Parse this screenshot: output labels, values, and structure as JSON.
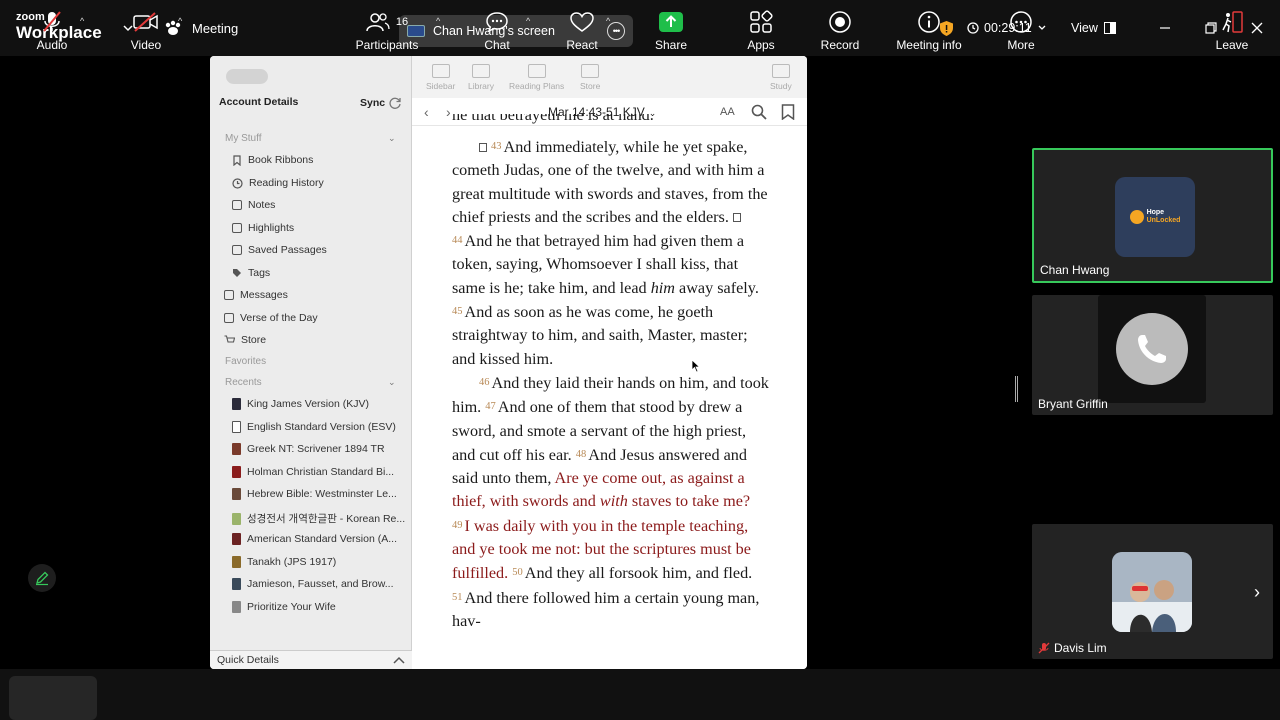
{
  "topbar": {
    "logo_top": "zoom",
    "logo_bottom": "Workplace",
    "meeting_label": "Meeting",
    "share_label": "Chan Hwang's screen",
    "timer": "00:29:11",
    "view_label": "View"
  },
  "bible_app": {
    "sidebar": {
      "account_details": "Account Details",
      "sync": "Sync",
      "my_stuff": "My Stuff",
      "my_stuff_items": [
        "Book Ribbons",
        "Reading History",
        "Notes",
        "Highlights",
        "Saved Passages",
        "Tags"
      ],
      "top_items": [
        "Messages",
        "Verse of the Day",
        "Store"
      ],
      "favorites": "Favorites",
      "recents": "Recents",
      "recent_items": [
        {
          "label": "King James Version (KJV)",
          "color": "#2b2b3a"
        },
        {
          "label": "English Standard Version (ESV)",
          "color": "#ffffff"
        },
        {
          "label": "Greek NT: Scrivener 1894 TR",
          "color": "#7a3a2a"
        },
        {
          "label": "Holman Christian Standard Bi...",
          "color": "#8a1c1c"
        },
        {
          "label": "Hebrew Bible: Westminster Le...",
          "color": "#6a4a3a"
        },
        {
          "label": "성경전서 개역한글판 - Korean Re...",
          "color": "#9ab36a"
        },
        {
          "label": "American Standard Version (A...",
          "color": "#6b2222"
        },
        {
          "label": "Tanakh (JPS 1917)",
          "color": "#8a6a2a"
        },
        {
          "label": "Jamieson, Fausset, and Brow...",
          "color": "#3a4a5a"
        },
        {
          "label": "Prioritize Your Wife",
          "color": "#888888"
        }
      ],
      "quick_details": "Quick Details"
    },
    "toolbar": {
      "sidebar": "Sidebar",
      "library": "Library",
      "reading_plans": "Reading Plans",
      "store": "Store",
      "study": "Study"
    },
    "reference": "Mar 14:43-51 KJV",
    "font_size_label": "AA",
    "passage": {
      "cutoff_line": "he that betrayeth me is at hand.",
      "v43_num": "43",
      "v43": "And immediately, while he yet spake, cometh Judas, one of the twelve, and with him a great multitude with swords and staves, from the chief priests and the scribes and the elders.",
      "v44_num": "44",
      "v44a": "And he that betrayed him had given them a token, saying, Whomsoever I shall kiss, that same is he; take him, and lead",
      "v44_italic": "him",
      "v44b": "away safely.",
      "v45_num": "45",
      "v45": "And as soon as he was come, he goeth straightway to him, and saith, Master, master; and kissed him.",
      "v46_num": "46",
      "v46": "And they laid their hands on him, and took him.",
      "v47_num": "47",
      "v47": "And one of them that stood by drew a sword, and smote a servant of the high priest, and cut off his ear.",
      "v48_num": "48",
      "v48a": "And Jesus answered and said unto them,",
      "v48_red_a": "Are ye come out, as against a thief, with swords and",
      "v48_red_italic": "with",
      "v48_red_b": "staves to take me?",
      "v49_num": "49",
      "v49_red": "I was daily with you in the temple teaching, and ye took me not: but the scriptures must be fulfilled.",
      "v50_num": "50",
      "v50": "And they all forsook him, and fled.",
      "v51_num": "51",
      "v51": "And there followed him a certain young man, hav-"
    }
  },
  "participants_panel": {
    "tiles": [
      {
        "name": "Chan Hwang",
        "logo_line1": "Hope",
        "logo_line2": "UnLocked"
      },
      {
        "name": "Bryant Griffin"
      },
      {
        "name": "Davis Lim"
      }
    ]
  },
  "bottombar": {
    "audio": "Audio",
    "video": "Video",
    "participants": "Participants",
    "participants_count": "16",
    "chat": "Chat",
    "react": "React",
    "share": "Share",
    "apps": "Apps",
    "record": "Record",
    "meeting_info": "Meeting info",
    "more": "More",
    "leave": "Leave"
  },
  "colors": {
    "active_speaker": "#37c95b",
    "share_green": "#1fbe4a",
    "red_letter": "#8b1a1a",
    "verse_number": "#b88a57"
  }
}
